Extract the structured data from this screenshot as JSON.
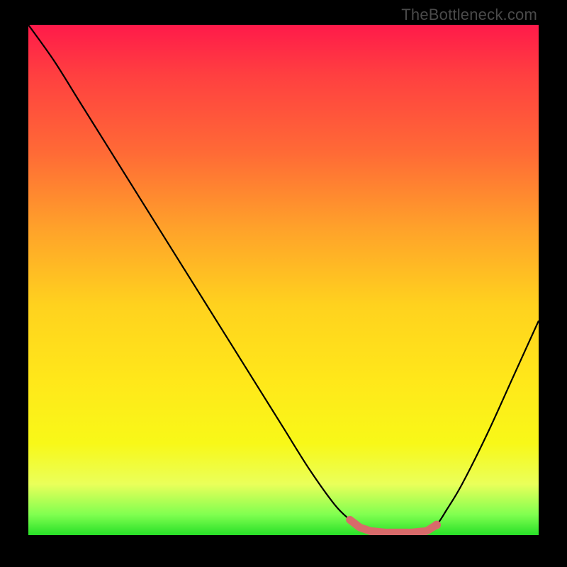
{
  "watermark": "TheBottleneck.com",
  "colors": {
    "background": "#000000",
    "curve": "#000000",
    "marker": "#d86a6a",
    "gradient_top": "#ff1a4a",
    "gradient_bottom": "#28e028"
  },
  "chart_data": {
    "type": "line",
    "title": "",
    "xlabel": "",
    "ylabel": "",
    "xlim": [
      0,
      100
    ],
    "ylim": [
      0,
      100
    ],
    "x": [
      0,
      5,
      10,
      15,
      20,
      25,
      30,
      35,
      40,
      45,
      50,
      55,
      60,
      63,
      65,
      67,
      70,
      72,
      75,
      78,
      80,
      82,
      85,
      90,
      95,
      100
    ],
    "y": [
      100,
      93,
      85,
      77,
      69,
      61,
      53,
      45,
      37,
      29,
      21,
      13,
      6,
      3,
      1.5,
      0.8,
      0.5,
      0.5,
      0.5,
      0.8,
      2,
      5,
      10,
      20,
      31,
      42
    ],
    "optimum_range_x": [
      63,
      80
    ],
    "marker_x": 80,
    "marker_y": 2
  }
}
